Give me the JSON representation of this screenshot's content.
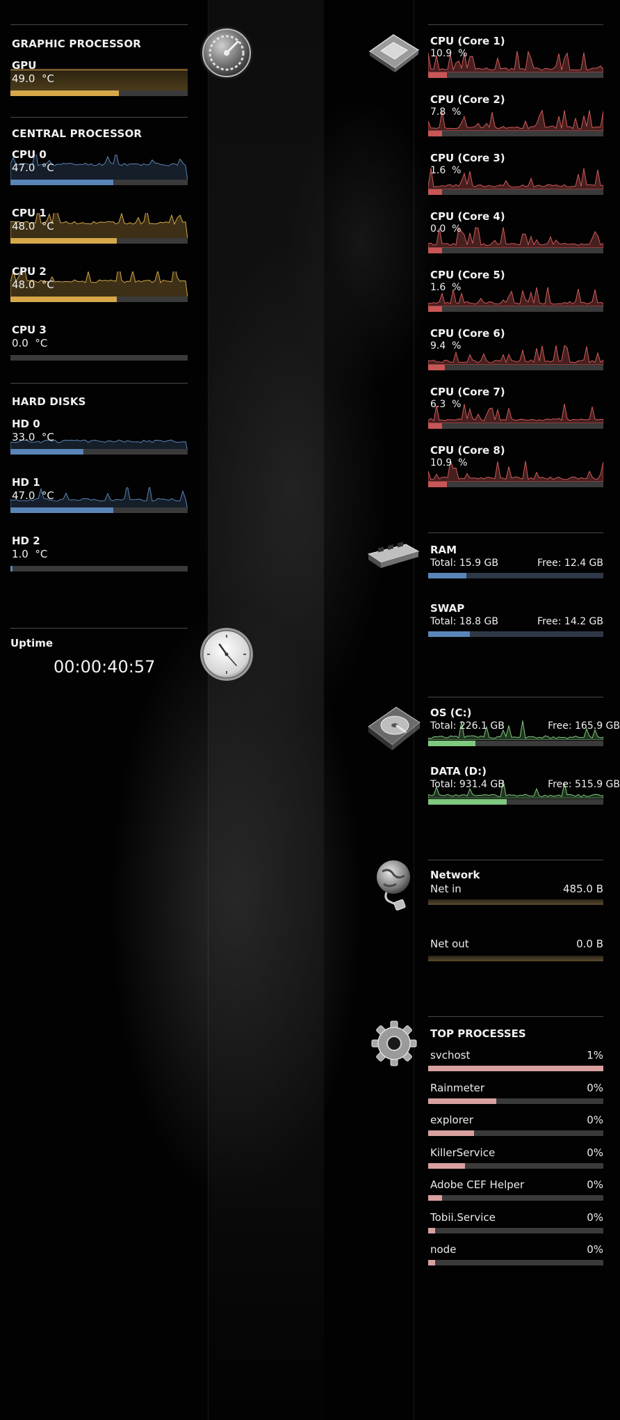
{
  "left": {
    "gpu_section": {
      "title": "GRAPHIC PROCESSOR"
    },
    "gpu": {
      "label": "GPU",
      "value": "49.0",
      "unit": "°C",
      "level": 0.61
    },
    "cpu_section": {
      "title": "CENTRAL PROCESSOR"
    },
    "cpus": [
      {
        "label": "CPU 0",
        "value": "47.0",
        "unit": "°C",
        "level": 0.58,
        "color": "#5a85b8"
      },
      {
        "label": "CPU 1",
        "value": "48.0",
        "unit": "°C",
        "level": 0.6,
        "color": "#d6a84a"
      },
      {
        "label": "CPU 2",
        "value": "48.0",
        "unit": "°C",
        "level": 0.6,
        "color": "#d6a84a"
      },
      {
        "label": "CPU 3",
        "value": "0.0",
        "unit": "°C",
        "level": 0.0,
        "color": "#5a85b8"
      }
    ],
    "disks_section": {
      "title": "HARD DISKS"
    },
    "disks": [
      {
        "label": "HD 0",
        "value": "33.0",
        "unit": "°C",
        "level": 0.41
      },
      {
        "label": "HD 1",
        "value": "47.0",
        "unit": "°C",
        "level": 0.58
      },
      {
        "label": "HD 2",
        "value": "1.0",
        "unit": "°C",
        "level": 0.01
      }
    ],
    "uptime": {
      "title": "Uptime",
      "value": "00:00:40:57"
    }
  },
  "right": {
    "cores": [
      {
        "label": "CPU (Core 1)",
        "value": "10.9",
        "unit": "%",
        "level": 0.109
      },
      {
        "label": "CPU (Core 2)",
        "value": "7.8",
        "unit": "%",
        "level": 0.078
      },
      {
        "label": "CPU (Core 3)",
        "value": "1.6",
        "unit": "%",
        "level": 0.016
      },
      {
        "label": "CPU (Core 4)",
        "value": "0.0",
        "unit": "%",
        "level": 0.0
      },
      {
        "label": "CPU (Core 5)",
        "value": "1.6",
        "unit": "%",
        "level": 0.016
      },
      {
        "label": "CPU (Core 6)",
        "value": "9.4",
        "unit": "%",
        "level": 0.094
      },
      {
        "label": "CPU (Core 7)",
        "value": "6.3",
        "unit": "%",
        "level": 0.063
      },
      {
        "label": "CPU (Core 8)",
        "value": "10.9",
        "unit": "%",
        "level": 0.109
      }
    ],
    "memory": [
      {
        "label": "RAM",
        "total_label": "Total:",
        "total": "15.9 GB",
        "free_label": "Free:",
        "free": "12.4 GB",
        "level": 0.22
      },
      {
        "label": "SWAP",
        "total_label": "Total:",
        "total": "18.8 GB",
        "free_label": "Free:",
        "free": "14.2 GB",
        "level": 0.24
      }
    ],
    "drives": [
      {
        "label": "OS (C:)",
        "total_label": "Total:",
        "total": "226.1 GB",
        "free_label": "Free:",
        "free": "165.9 GB",
        "level": 0.27
      },
      {
        "label": "DATA (D:)",
        "total_label": "Total:",
        "total": "931.4 GB",
        "free_label": "Free:",
        "free": "515.9 GB",
        "level": 0.45
      }
    ],
    "network": {
      "title": "Network",
      "in_label": "Net in",
      "in_value": "485.0 B",
      "out_label": "Net out",
      "out_value": "0.0 B"
    },
    "processes": {
      "title": "TOP PROCESSES",
      "items": [
        {
          "name": "svchost",
          "value": "1%",
          "level": 1.0
        },
        {
          "name": "Rainmeter",
          "value": "0%",
          "level": 0.39
        },
        {
          "name": "explorer",
          "value": "0%",
          "level": 0.26
        },
        {
          "name": "KillerService",
          "value": "0%",
          "level": 0.21
        },
        {
          "name": "Adobe CEF Helper",
          "value": "0%",
          "level": 0.08
        },
        {
          "name": "Tobii.Service",
          "value": "0%",
          "level": 0.04
        },
        {
          "name": "node",
          "value": "0%",
          "level": 0.04
        }
      ]
    }
  },
  "colors": {
    "gold": "#d6a84a",
    "blue": "#5a85b8",
    "red": "#c85656",
    "green": "#7fc87f",
    "pink": "#d9a0a0",
    "track": "#3a3a3a"
  },
  "icons": [
    "gauge-icon",
    "clock-icon",
    "processor-chip-icon",
    "ram-module-icon",
    "hard-drive-icon",
    "network-globe-icon",
    "gear-icon"
  ]
}
